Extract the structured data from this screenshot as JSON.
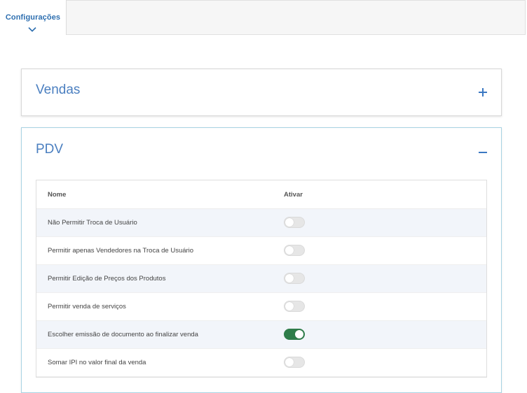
{
  "tabs": {
    "active_label": "Configurações"
  },
  "panels": {
    "vendas": {
      "title": "Vendas",
      "expanded": false
    },
    "pdv": {
      "title": "PDV",
      "expanded": true
    }
  },
  "table": {
    "col_nome": "Nome",
    "col_ativar": "Ativar",
    "rows": [
      {
        "label": "Não Permitir Troca de Usuário",
        "active": false
      },
      {
        "label": "Permitir apenas Vendedores na Troca de Usuário",
        "active": false
      },
      {
        "label": "Permitir Edição de Preços dos Produtos",
        "active": false
      },
      {
        "label": "Permitir venda de serviços",
        "active": false
      },
      {
        "label": "Escolher emissão de documento ao finalizar venda",
        "active": true
      },
      {
        "label": "Somar IPI no valor final da venda",
        "active": false
      }
    ]
  },
  "colors": {
    "accent": "#4b7fc0",
    "toggle_on": "#2f7d4a",
    "toggle_off": "#e6e6e6"
  }
}
